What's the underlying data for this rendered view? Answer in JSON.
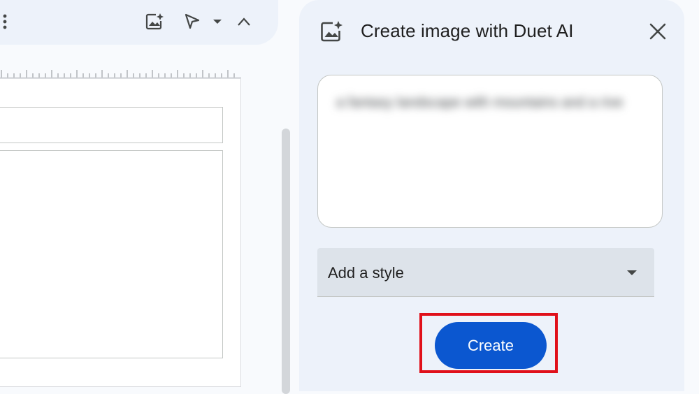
{
  "toolbar": {
    "icons": [
      "more-vert-icon",
      "image-sparkle-icon",
      "pointer-icon",
      "caret-down-icon",
      "chevron-up-icon"
    ]
  },
  "panel": {
    "title": "Create image with Duet AI",
    "prompt_text": "a fantasy landscape with mountains and a river at sunset",
    "style_placeholder": "Add a style",
    "create_label": "Create"
  },
  "colors": {
    "primary_button": "#0b57d0",
    "highlight_box": "#e0101a",
    "panel_background": "#edf2fa",
    "select_background": "#dde3ea"
  }
}
